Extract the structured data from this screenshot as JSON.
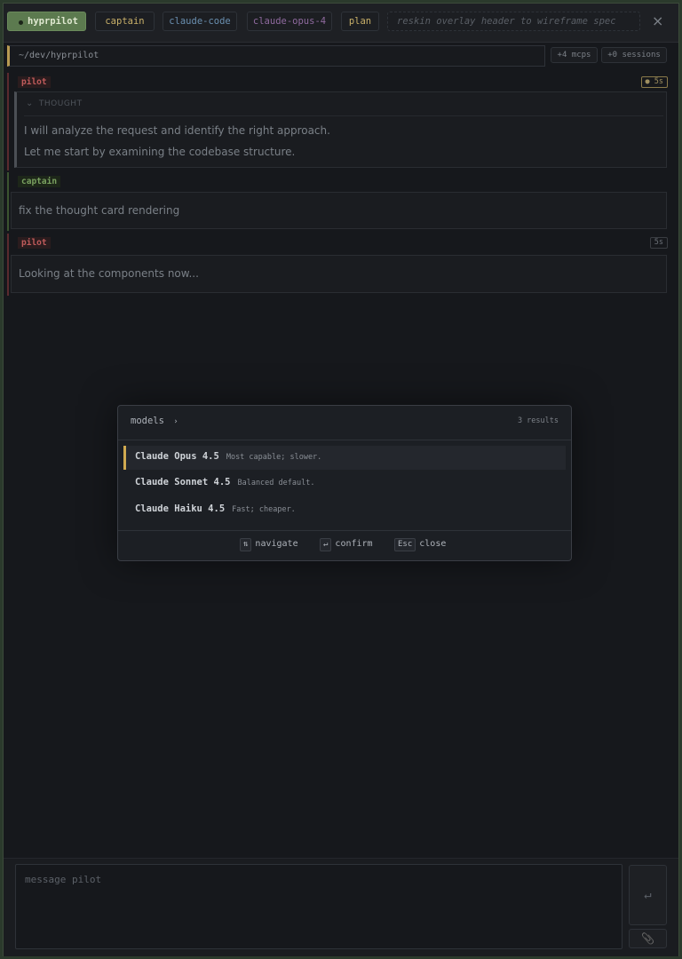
{
  "header": {
    "app_name": "hyprpilot",
    "role": "captain",
    "agent": "claude-code",
    "model": "claude-opus-4",
    "mode": "plan",
    "task": "reskin overlay header to wireframe spec",
    "close_icon": "×"
  },
  "context": {
    "path": "~/dev/hyprpilot",
    "mcps": "+4 mcps",
    "sessions": "+0 sessions"
  },
  "messages": [
    {
      "role": "pilot",
      "time": "● 5s",
      "thought": {
        "label": "THOUGHT",
        "chevron": "⌄",
        "lines": [
          "I will analyze the request and identify the right approach.",
          "Let me start by examining the codebase structure."
        ]
      }
    },
    {
      "role": "captain",
      "text": "fix the thought card rendering"
    },
    {
      "role": "pilot",
      "time": "5s",
      "text": "Looking at the components now..."
    }
  ],
  "palette": {
    "title": "models",
    "chevron": "›",
    "count": "3 results",
    "options": [
      {
        "name": "Claude Opus 4.5",
        "desc": "Most capable; slower."
      },
      {
        "name": "Claude Sonnet 4.5",
        "desc": "Balanced default."
      },
      {
        "name": "Claude Haiku 4.5",
        "desc": "Fast; cheaper."
      }
    ],
    "hints": [
      {
        "key": "⇅",
        "label": "navigate"
      },
      {
        "key": "↵",
        "label": "confirm"
      },
      {
        "key": "Esc",
        "label": "close"
      }
    ]
  },
  "composer": {
    "placeholder": "message pilot",
    "send_icon": "↵",
    "attach_icon": "📎"
  },
  "colors": {
    "accent": "#5c7a4f",
    "pilot": "#c05b5b",
    "captain": "#79a05f",
    "selection": "#d0a950"
  }
}
